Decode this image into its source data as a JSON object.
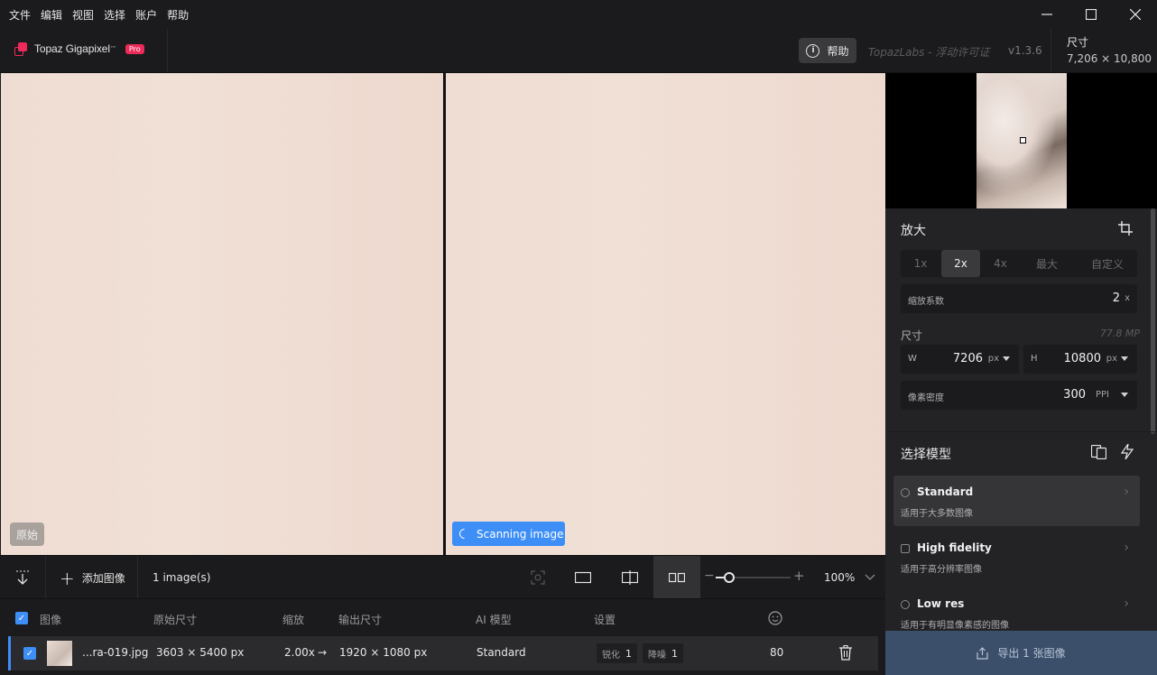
{
  "menu": [
    "文件",
    "编辑",
    "视图",
    "选择",
    "账户",
    "帮助"
  ],
  "app": {
    "name": "Topaz Gigapixel",
    "tm": "™",
    "badge": "Pro"
  },
  "header": {
    "help": "帮助",
    "license": "TopazLabs - 浮动许可证",
    "version": "v1.3.6",
    "size_label": "尺寸",
    "size_value": "7,206 × 10,800"
  },
  "preview": {
    "original_badge": "原始",
    "scanning": "Scanning image"
  },
  "toolbar": {
    "add_image": "添加图像",
    "count": "1 image(s)",
    "zoom": "100%",
    "zoom_fraction": 0.17
  },
  "list": {
    "headers": {
      "image": "图像",
      "orig_size": "原始尺寸",
      "scale": "缩放",
      "out_size": "输出尺寸",
      "model": "AI 模型",
      "settings": "设置"
    },
    "row": {
      "name": "...ra-019.jpg",
      "orig": "3603 × 5400 px",
      "scale": "2.00x",
      "arrow": "→",
      "out": "1920 × 1080 px",
      "model": "Standard",
      "sharpen_label": "锐化",
      "sharpen": "1",
      "denoise_label": "降噪",
      "denoise": "1",
      "score": "80",
      "checked": true
    }
  },
  "side": {
    "upscale_title": "放大",
    "scale_options": [
      "1x",
      "2x",
      "4x",
      "最大",
      "自定义"
    ],
    "selected_scale": "2x",
    "factor_label": "缩放系数",
    "factor_value": "2",
    "factor_unit": "x",
    "dim_title": "尺寸",
    "megapixels": "77.8 MP",
    "w_label": "W",
    "w_value": "7206",
    "w_unit": "px",
    "h_label": "H",
    "h_value": "10800",
    "h_unit": "px",
    "ppi_label": "像素密度",
    "ppi_value": "300",
    "ppi_unit": "PPI",
    "model_title": "选择模型",
    "models": [
      {
        "name": "Standard",
        "desc": "适用于大多数图像"
      },
      {
        "name": "High fidelity",
        "desc": "适用于高分辨率图像"
      },
      {
        "name": "Low res",
        "desc": "适用于有明显像素感的图像"
      }
    ],
    "selected_model": "Standard",
    "export": "导出 1 张图像"
  },
  "colors": {
    "accent": "#3d8ef7",
    "brand": "#ee2a5a",
    "export_bg": "#3b4f6b"
  }
}
